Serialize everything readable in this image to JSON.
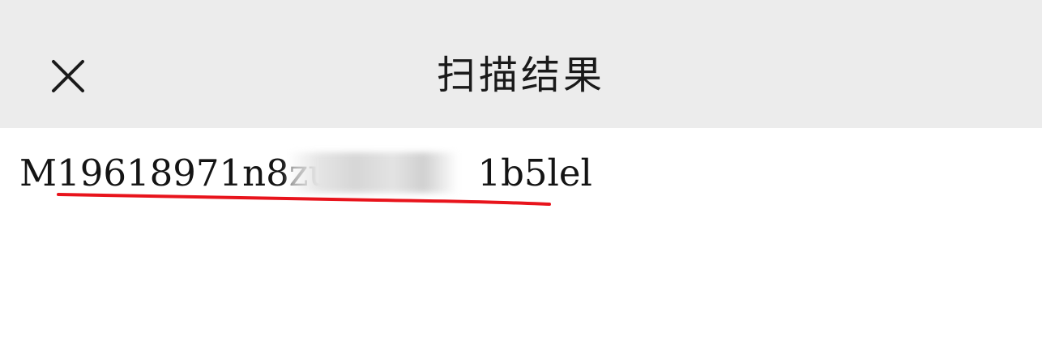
{
  "header": {
    "title": "扫描结果",
    "close_icon": "close-icon",
    "background": "#ececec"
  },
  "result": {
    "text": "M19618971n8zu",
    "text_suffix": "1b5lel",
    "annotation_color": "#e8141c"
  }
}
